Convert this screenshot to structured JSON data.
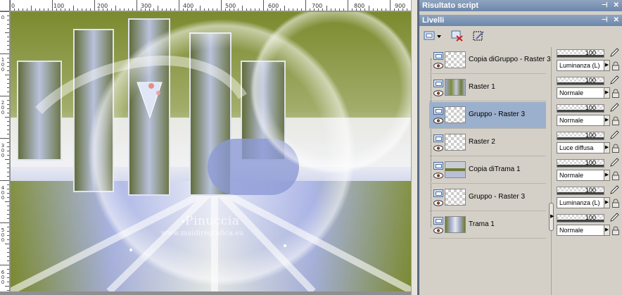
{
  "ruler": {
    "top_labels": [
      "0",
      "100",
      "200",
      "300",
      "400",
      "500",
      "600",
      "700",
      "800",
      "900"
    ],
    "left_labels": [
      "0",
      "100",
      "200",
      "300",
      "400",
      "500",
      "600"
    ]
  },
  "canvas": {
    "watermark_name": "Pinuccia",
    "watermark_url": "www.maidiregrafica.eu"
  },
  "script_palette": {
    "title": "Risultato script",
    "icons": [
      "pin-icon",
      "close-icon"
    ]
  },
  "layers_palette": {
    "title": "Livelli",
    "icons": [
      "pin-icon",
      "close-icon"
    ],
    "toolbar": [
      "new-raster-layer-icon",
      "delete-layer-icon",
      "new-mask-layer-icon"
    ],
    "selected_index": 2,
    "layers": [
      {
        "name": "Copia diGruppo - Raster 3",
        "opacity": "100",
        "blend": "Luminanza (L)",
        "thumb": "transparent"
      },
      {
        "name": "Raster 1",
        "opacity": "100",
        "blend": "Normale",
        "thumb": "image"
      },
      {
        "name": "Gruppo - Raster 3",
        "opacity": "100",
        "blend": "Normale",
        "thumb": "transparent"
      },
      {
        "name": "Raster 2",
        "opacity": "100",
        "blend": "Luce diffusa",
        "thumb": "transparent"
      },
      {
        "name": "Copia diTrama 1",
        "opacity": "100",
        "blend": "Normale",
        "thumb": "image"
      },
      {
        "name": "Gruppo - Raster 3",
        "opacity": "100",
        "blend": "Luminanza (L)",
        "thumb": "transparent"
      },
      {
        "name": "Trama 1",
        "opacity": "100",
        "blend": "Normale",
        "thumb": "image"
      }
    ]
  },
  "colors": {
    "title_bar": "#7a92b5",
    "selected_row": "#9bb0cc",
    "olive": "#7b8a2e",
    "lavender": "#a9b3e6"
  }
}
